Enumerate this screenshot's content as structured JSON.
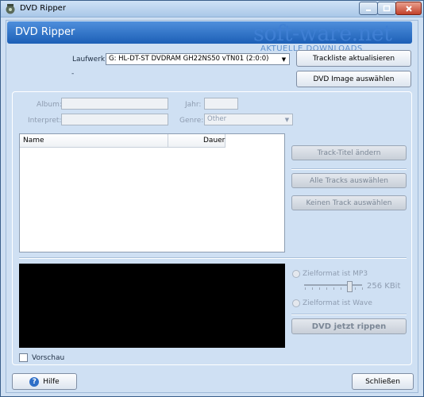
{
  "window": {
    "title": "DVD Ripper"
  },
  "header": {
    "title": "DVD Ripper"
  },
  "watermark": {
    "brand": "soft-ware.net",
    "tagline": "AKTUELLE DOWNLOADS"
  },
  "drive": {
    "label": "Laufwerk:",
    "value": "G: HL-DT-ST DVDRAM GH22NS50 vTN01 (2:0:0)",
    "status": "-"
  },
  "top_buttons": {
    "refresh": "Trackliste aktualisieren",
    "select_image": "DVD Image auswählen"
  },
  "meta": {
    "album_label": "Album:",
    "artist_label": "Interpret:",
    "year_label": "Jahr:",
    "genre_label": "Genre:",
    "genre_value": "Other"
  },
  "tracklist": {
    "columns": [
      "Name",
      "Dauer"
    ]
  },
  "track_buttons": {
    "rename": "Track-Titel ändern",
    "select_all": "Alle Tracks auswählen",
    "select_none": "Keinen Track auswählen"
  },
  "format": {
    "mp3_label": "Zielformat ist MP3",
    "bitrate": "256 KBit",
    "wave_label": "Zielformat ist Wave"
  },
  "rip_button": "DVD jetzt rippen",
  "preview_label": "Vorschau",
  "footer": {
    "help": "Hilfe",
    "close": "Schließen"
  },
  "colors": {
    "header_blue": "#1c5fb6",
    "window_bg": "#cfe0f3"
  }
}
